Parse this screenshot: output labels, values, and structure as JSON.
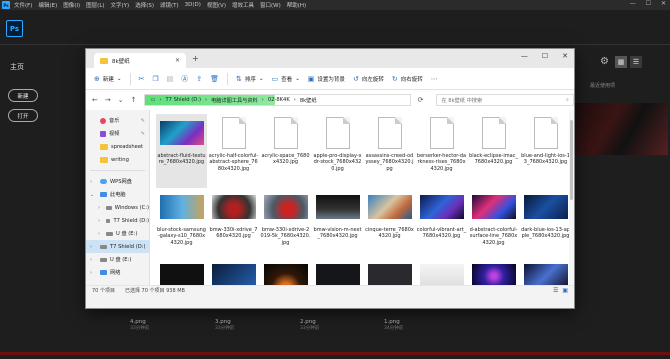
{
  "menubar": {
    "app_abbrev": "Ps",
    "items": [
      "文件(F)",
      "编辑(E)",
      "图像(I)",
      "图层(L)",
      "文字(Y)",
      "选择(S)",
      "滤镜(T)",
      "3D(D)",
      "视图(V)",
      "增效工具",
      "窗口(W)",
      "帮助(H)"
    ],
    "win_min": "—",
    "win_max": "☐",
    "win_close": "✕"
  },
  "ps": {
    "logo": "Ps",
    "home_label": "主页",
    "new_label": "新建",
    "open_label": "打开",
    "recent_label": "最近使用项",
    "bottom_files": [
      {
        "name": "4.png",
        "meta": "33分钟前"
      },
      {
        "name": "3.png",
        "meta": "33分钟前"
      },
      {
        "name": "2.png",
        "meta": "33分钟前"
      },
      {
        "name": "1.png",
        "meta": "34分钟前"
      }
    ]
  },
  "explorer": {
    "tab_title": "8k壁纸",
    "toolbar": {
      "new": "新建",
      "sort": "排序",
      "view": "查看",
      "wallpaper": "设置为背景",
      "rotate_left": "向左旋转",
      "rotate_right": "向右旋转"
    },
    "address": [
      "T7 Shield (D:)",
      "电脑详图工具与资料",
      "02-8K4K",
      "8k壁纸"
    ],
    "search_placeholder": "在 8k壁纸 中搜索",
    "nav": [
      {
        "label": "音乐",
        "icon": "music-icon"
      },
      {
        "label": "视频",
        "icon": "video-icon"
      },
      {
        "label": "spreadsheet",
        "icon": "folder-icon"
      },
      {
        "label": "writing",
        "icon": "folder-icon"
      },
      {
        "label": "WPS网盘",
        "icon": "cloud-icon"
      },
      {
        "label": "此电脑",
        "icon": "pc-icon"
      },
      {
        "label": "Windows (C:)",
        "icon": "drive-icon"
      },
      {
        "label": "T7 Shield (D:)",
        "icon": "drive-icon"
      },
      {
        "label": "U 盘 (E:)",
        "icon": "drive-icon"
      },
      {
        "label": "T7 Shield (D:)",
        "icon": "drive-icon"
      },
      {
        "label": "U 盘 (E:)",
        "icon": "drive-icon"
      },
      {
        "label": "网络",
        "icon": "network-icon"
      }
    ],
    "files_row1": [
      "abstract-fluid-texture_7680x4320.jpg",
      "acrylic-half-colorful-abstract-sphere_7680x4320.jpg",
      "acrylic-space_7680x4320.jpg",
      "apple-pro-display-xdr-stock_7680x4320.jpg",
      "assassins-creed-odyssey_7680x4320.jpg",
      "berserker-hector-darkness-rises_7680x4320.jpg",
      "black-eclipse-imac_7680x4320.jpg",
      "blue-and-light-ios-13_7680x4320.jpg"
    ],
    "files_row2": [
      "blur-stock-samsung-galaxy-s10_7680x4320.jpg",
      "bmw-330i-xdrive_7680x4320.jpg",
      "bmw-330i-xdrive-2019-5k_7680x4320.jpg",
      "bmw-vision-m-next_7680x4320.jpg",
      "cinque-terre_7680x4320.jpg",
      "colorful-vibrant-art_7680x4320.jpg",
      "d-abstract-colorful-surface-line_7680x4320.jpg",
      "dark-blue-ios-13-apple_7680x4320.jpg"
    ],
    "status": {
      "count": "70 个项目",
      "selected": "已选择 70 个项目  938 MB"
    }
  }
}
